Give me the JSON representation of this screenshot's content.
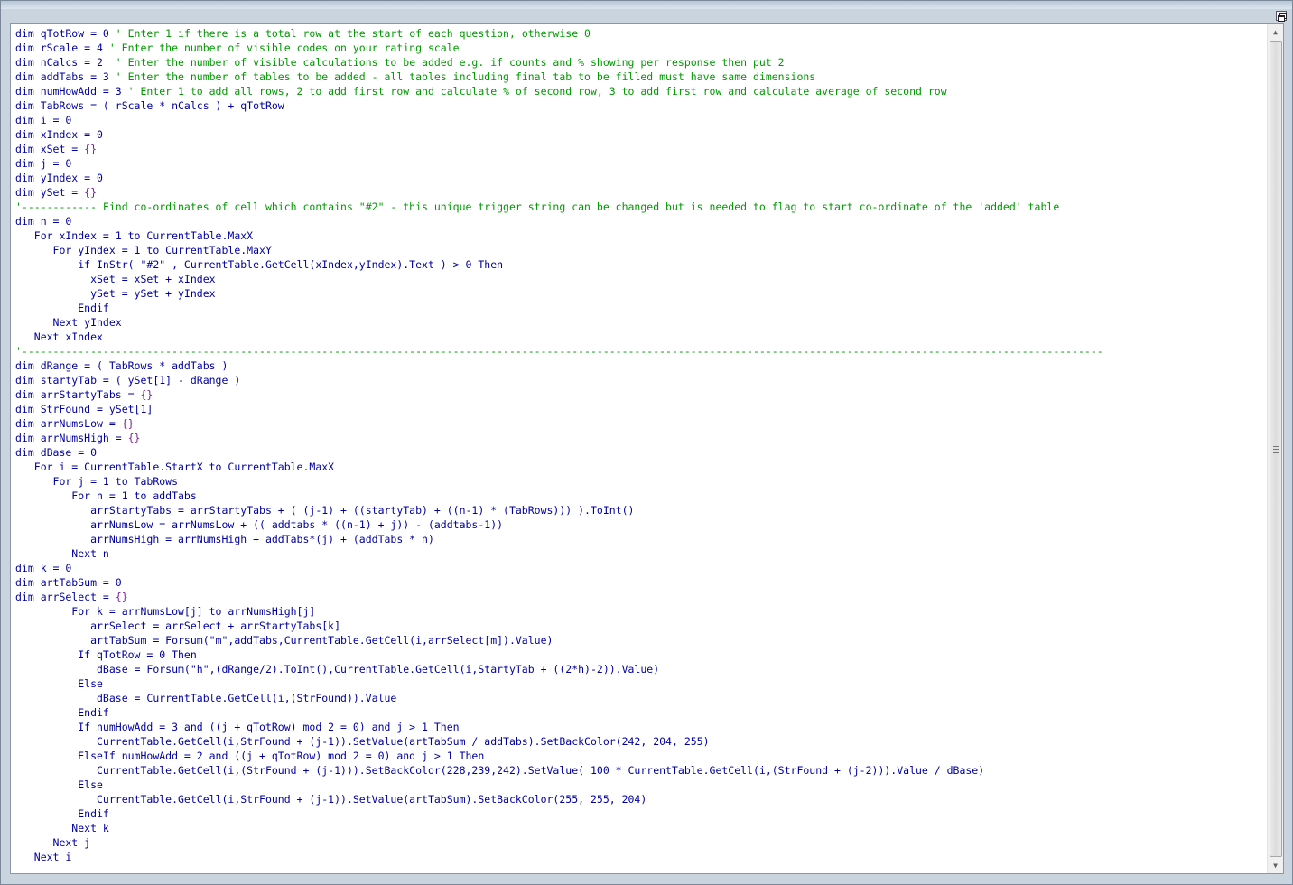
{
  "window": {
    "restore_icon": "restore-window-icon"
  },
  "scrollbar": {
    "up_glyph": "▲",
    "down_glyph": "▼"
  },
  "code_lines": [
    "dim qTotRow = 0 ' Enter 1 if there is a total row at the start of each question, otherwise 0",
    "dim rScale = 4 ' Enter the number of visible codes on your rating scale",
    "dim nCalcs = 2  ' Enter the number of visible calculations to be added e.g. if counts and % showing per response then put 2",
    "dim addTabs = 3 ' Enter the number of tables to be added - all tables including final tab to be filled must have same dimensions",
    "dim numHowAdd = 3 ' Enter 1 to add all rows, 2 to add first row and calculate % of second row, 3 to add first row and calculate average of second row",
    "dim TabRows = ( rScale * nCalcs ) + qTotRow",
    "dim i = 0",
    "dim xIndex = 0",
    "dim xSet = {}",
    "dim j = 0",
    "dim yIndex = 0",
    "dim ySet = {}",
    "'------------ Find co-ordinates of cell which contains \"#2\" - this unique trigger string can be changed but is needed to flag to start co-ordinate of the 'added' table",
    "dim n = 0",
    "   For xIndex = 1 to CurrentTable.MaxX",
    "      For yIndex = 1 to CurrentTable.MaxY",
    "          if InStr( \"#2\" , CurrentTable.GetCell(xIndex,yIndex).Text ) > 0 Then",
    "            xSet = xSet + xIndex",
    "            ySet = ySet + yIndex",
    "          Endif",
    "      Next yIndex",
    "   Next xIndex",
    "'-----------------------------------------------------------------------------------------------------------------------------------------------------------------------------",
    "dim dRange = ( TabRows * addTabs )",
    "dim startyTab = ( ySet[1] - dRange )",
    "dim arrStartyTabs = {}",
    "dim StrFound = ySet[1]",
    "dim arrNumsLow = {}",
    "dim arrNumsHigh = {}",
    "dim dBase = 0",
    "   For i = CurrentTable.StartX to CurrentTable.MaxX",
    "      For j = 1 to TabRows",
    "         For n = 1 to addTabs",
    "            arrStartyTabs = arrStartyTabs + ( (j-1) + ((startyTab) + ((n-1) * (TabRows))) ).ToInt()",
    "            arrNumsLow = arrNumsLow + (( addtabs * ((n-1) + j)) - (addtabs-1))",
    "            arrNumsHigh = arrNumsHigh + addTabs*(j) + (addTabs * n)",
    "         Next n",
    "dim k = 0",
    "dim artTabSum = 0",
    "dim arrSelect = {}",
    "         For k = arrNumsLow[j] to arrNumsHigh[j]",
    "            arrSelect = arrSelect + arrStartyTabs[k]",
    "            artTabSum = Forsum(\"m\",addTabs,CurrentTable.GetCell(i,arrSelect[m]).Value)",
    "          If qTotRow = 0 Then",
    "             dBase = Forsum(\"h\",(dRange/2).ToInt(),CurrentTable.GetCell(i,StartyTab + ((2*h)-2)).Value)",
    "          Else",
    "             dBase = CurrentTable.GetCell(i,(StrFound)).Value",
    "          Endif",
    "          If numHowAdd = 3 and ((j + qTotRow) mod 2 = 0) and j > 1 Then",
    "             CurrentTable.GetCell(i,StrFound + (j-1)).SetValue(artTabSum / addTabs).SetBackColor(242, 204, 255)",
    "          ElseIf numHowAdd = 2 and ((j + qTotRow) mod 2 = 0) and j > 1 Then",
    "             CurrentTable.GetCell(i,(StrFound + (j-1))).SetBackColor(228,239,242).SetValue( 100 * CurrentTable.GetCell(i,(StrFound + (j-2))).Value / dBase)",
    "          Else",
    "             CurrentTable.GetCell(i,StrFound + (j-1)).SetValue(artTabSum).SetBackColor(255, 255, 204)",
    "          Endif",
    "         Next k",
    "      Next j",
    "   Next i"
  ],
  "colors": {
    "code": "#0000a0",
    "comment": "#009900",
    "brace": "#7a1fa2",
    "editor_bg": "#ffffff",
    "window_bg": "#c9d4de"
  }
}
